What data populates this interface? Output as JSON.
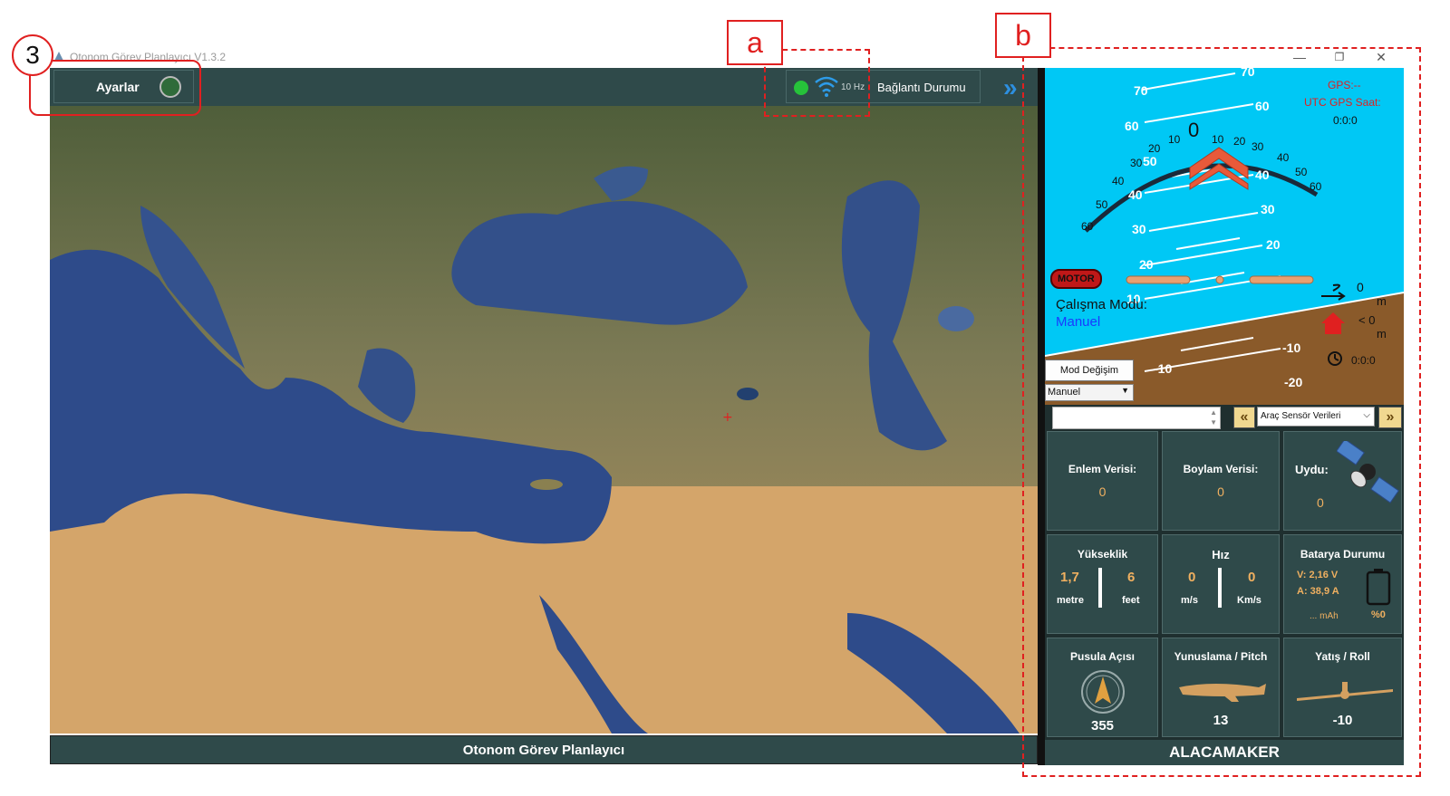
{
  "window": {
    "title": "Otonom Görev Planlayıcı V1.3.2",
    "minimize": "—",
    "restore": "❐",
    "close": "✕"
  },
  "topbar": {
    "settings_label": "Ayarlar",
    "frequency": "10 Hz",
    "connection_label": "Bağlantı Durumu"
  },
  "footer": {
    "title": "Otonom Görev Planlayıcı"
  },
  "annotations": {
    "marker_3": "3",
    "marker_a": "a",
    "marker_b": "b"
  },
  "hud": {
    "gps": "GPS:--",
    "utc_label": "UTC GPS Saat:",
    "utc_value": "0:0:0",
    "motor": "MOTOR",
    "mode_label": "Çalışma Modu:",
    "mode_value": "Manuel",
    "distance_value": "0",
    "distance_unit": "m",
    "home_value": "< 0",
    "home_unit": "m",
    "timer": "0:0:0",
    "ladder_left": [
      "70",
      "60",
      "50",
      "40",
      "30",
      "20",
      "10",
      "-10"
    ],
    "ladder_right": [
      "70",
      "60",
      "50",
      "40",
      "30",
      "20",
      "10",
      "-10",
      "-20"
    ],
    "arc_left": [
      "10",
      "20",
      "30",
      "40",
      "50",
      "60"
    ],
    "arc_right": [
      "10",
      "20",
      "30",
      "40",
      "50",
      "60"
    ],
    "arc_zero": "0"
  },
  "controls": {
    "mode_change_button": "Mod Değişim",
    "mode_select_value": "Manuel",
    "sensor_select_value": "Araç Sensör Verileri"
  },
  "tiles": {
    "latitude_label": "Enlem Verisi:",
    "latitude_value": "0",
    "longitude_label": "Boylam Verisi:",
    "longitude_value": "0",
    "satellite_label": "Uydu:",
    "satellite_value": "0",
    "altitude_label": "Yükseklik",
    "altitude_metre": "1,7",
    "altitude_metre_unit": "metre",
    "altitude_feet": "6",
    "altitude_feet_unit": "feet",
    "speed_label": "Hız",
    "speed_ms": "0",
    "speed_ms_unit": "m/s",
    "speed_kmh": "0",
    "speed_kmh_unit": "Km/s",
    "battery_label": "Batarya Durumu",
    "battery_voltage": "V: 2,16 V",
    "battery_current": "A: 38,9 A",
    "battery_mah": "... mAh",
    "battery_percent": "%0",
    "compass_label": "Pusula Açısı",
    "compass_value": "355",
    "pitch_label": "Yunuslama / Pitch",
    "pitch_value": "13",
    "roll_label": "Yatış / Roll",
    "roll_value": "-10"
  },
  "brand": "ALACAMAKER",
  "colors": {
    "panel": "#2f4a4a",
    "sky": "#00c8f5",
    "ground": "#8a5a2a",
    "accent_blue": "#2d8fe0",
    "annotation_red": "#e02020",
    "value_orange": "#f0b060"
  }
}
